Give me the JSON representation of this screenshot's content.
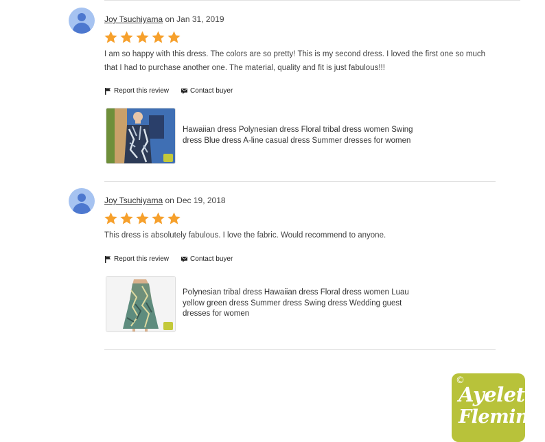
{
  "reviews": [
    {
      "username": "Joy Tsuchiyama",
      "date_prefix": " on ",
      "date": "Jan 31, 2019",
      "rating": 5,
      "text": "I am so happy with this dress. The colors are so pretty! This is my second dress. I loved the first one so much that I had to purchase another one. The material, quality and fit is just fabulous!!!",
      "report_label": "Report this review",
      "contact_label": "Contact buyer",
      "listing_title": "Hawaiian dress Polynesian dress Floral tribal dress women Swing dress Blue dress A-line casual dress Summer dresses for women"
    },
    {
      "username": "Joy Tsuchiyama",
      "date_prefix": " on ",
      "date": "Dec 19, 2018",
      "rating": 5,
      "text": "This dress is absolutely fabulous. I love the fabric. Would recommend to anyone.",
      "report_label": "Report this review",
      "contact_label": "Contact buyer",
      "listing_title": "Polynesian tribal dress Hawaiian dress Floral dress women Luau yellow green dress Summer dress Swing dress Wedding guest dresses for women"
    }
  ],
  "watermark": {
    "symbol": "©",
    "line1": "Ayelet",
    "line2": "Fleming"
  },
  "colors": {
    "star": "#f6a02c",
    "avatar_bg": "#a6c3f1",
    "avatar_fg": "#4d78cf",
    "badge": "#b8c23a"
  },
  "icons": {
    "star": "star-icon",
    "flag": "flag-icon",
    "message": "message-icon"
  }
}
